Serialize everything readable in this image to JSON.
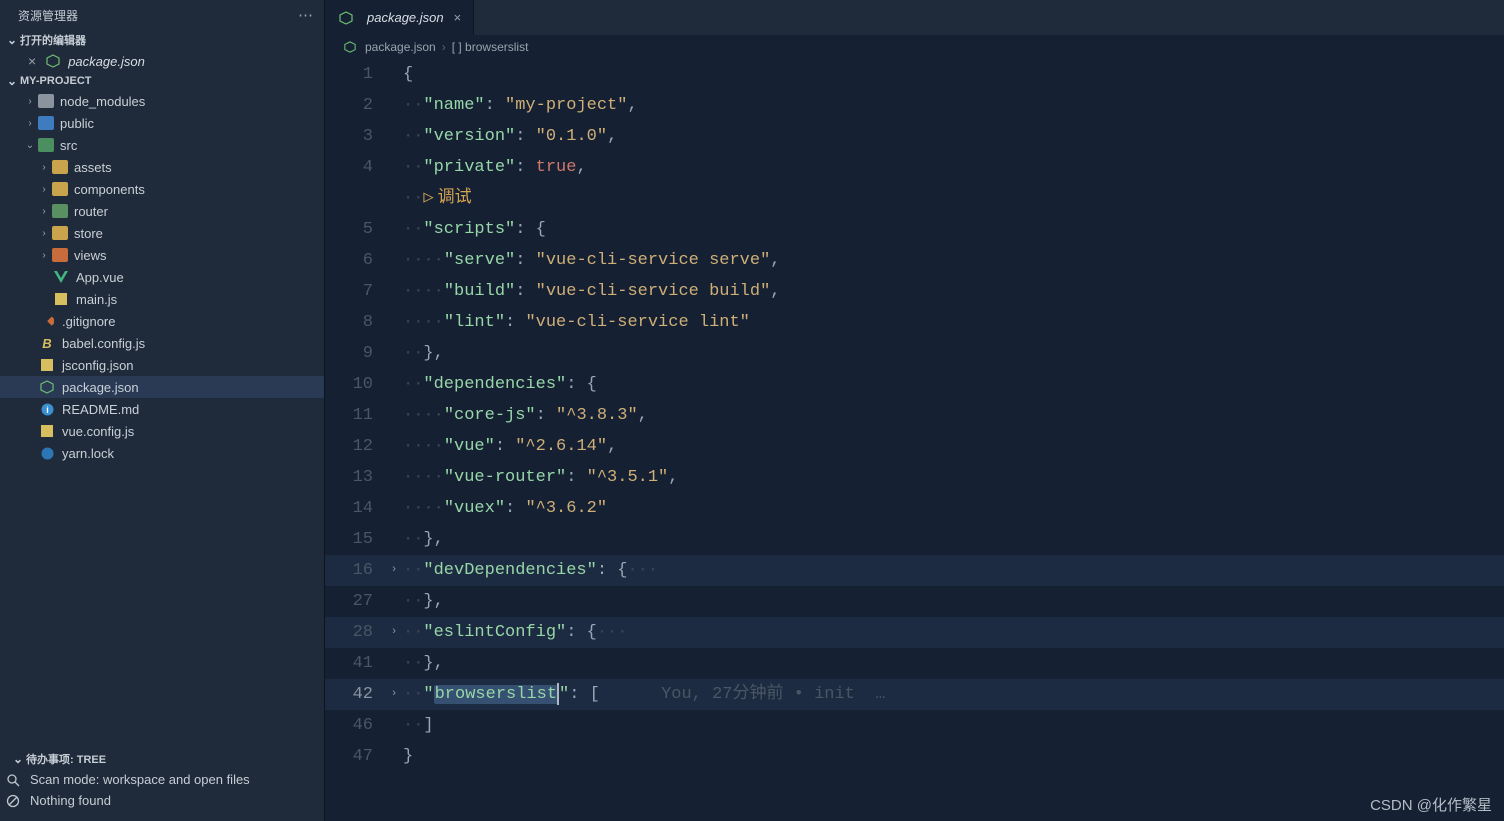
{
  "sidebar": {
    "title": "资源管理器",
    "openEditorsLabel": "打开的编辑器",
    "openItem": "package.json",
    "project": "MY-PROJECT",
    "tree": [
      {
        "d": 1,
        "ar": "›",
        "t": "f",
        "lab": "node_modules",
        "c": "#8b949e"
      },
      {
        "d": 1,
        "ar": "›",
        "t": "f",
        "lab": "public",
        "c": "#3f7bbf"
      },
      {
        "d": 1,
        "ar": "⌄",
        "t": "f",
        "lab": "src",
        "c": "#4b8f61"
      },
      {
        "d": 2,
        "ar": "›",
        "t": "f",
        "lab": "assets",
        "c": "#c9a44c"
      },
      {
        "d": 2,
        "ar": "›",
        "t": "f",
        "lab": "components",
        "c": "#c9a44c"
      },
      {
        "d": 2,
        "ar": "›",
        "t": "f",
        "lab": "router",
        "c": "#5a8f61"
      },
      {
        "d": 2,
        "ar": "›",
        "t": "f",
        "lab": "store",
        "c": "#c9a44c"
      },
      {
        "d": 2,
        "ar": "›",
        "t": "f",
        "lab": "views",
        "c": "#c76c3a"
      },
      {
        "d": 2,
        "ar": "",
        "t": "vue",
        "lab": "App.vue"
      },
      {
        "d": 2,
        "ar": "",
        "t": "js",
        "lab": "main.js"
      },
      {
        "d": 1,
        "ar": "",
        "t": "git",
        "lab": ".gitignore"
      },
      {
        "d": 1,
        "ar": "",
        "t": "babel",
        "lab": "babel.config.js"
      },
      {
        "d": 1,
        "ar": "",
        "t": "jscfg",
        "lab": "jsconfig.json"
      },
      {
        "d": 1,
        "ar": "",
        "t": "npm",
        "lab": "package.json",
        "sel": true
      },
      {
        "d": 1,
        "ar": "",
        "t": "info",
        "lab": "README.md"
      },
      {
        "d": 1,
        "ar": "",
        "t": "js",
        "lab": "vue.config.js"
      },
      {
        "d": 1,
        "ar": "",
        "t": "yarn",
        "lab": "yarn.lock"
      }
    ],
    "todo": {
      "header": "待办事项: TREE",
      "scan": "Scan mode: workspace and open files",
      "nothing": "Nothing found"
    }
  },
  "tab": {
    "label": "package.json"
  },
  "breadcrumb": {
    "file": "package.json",
    "path": "[ ] browserslist"
  },
  "debug": "调试",
  "blame": "You, 27分钟前 • init  …",
  "code": {
    "name_k": "\"name\"",
    "name_v": "\"my-project\"",
    "ver_k": "\"version\"",
    "ver_v": "\"0.1.0\"",
    "priv_k": "\"private\"",
    "priv_v": "true",
    "scripts_k": "\"scripts\"",
    "serve_k": "\"serve\"",
    "serve_v": "\"vue-cli-service serve\"",
    "build_k": "\"build\"",
    "build_v": "\"vue-cli-service build\"",
    "lint_k": "\"lint\"",
    "lint_v": "\"vue-cli-service lint\"",
    "deps_k": "\"dependencies\"",
    "core_k": "\"core-js\"",
    "core_v": "\"^3.8.3\"",
    "vue_k": "\"vue\"",
    "vue_v": "\"^2.6.14\"",
    "vr_k": "\"vue-router\"",
    "vr_v": "\"^3.5.1\"",
    "vx_k": "\"vuex\"",
    "vx_v": "\"^3.6.2\"",
    "dev_k": "\"devDependencies\"",
    "es_k": "\"eslintConfig\"",
    "bl_k": "browserslist"
  },
  "ln": {
    "1": "1",
    "2": "2",
    "3": "3",
    "4": "4",
    "5": "5",
    "6": "6",
    "7": "7",
    "8": "8",
    "9": "9",
    "10": "10",
    "11": "11",
    "12": "12",
    "13": "13",
    "14": "14",
    "15": "15",
    "16": "16",
    "27": "27",
    "28": "28",
    "41": "41",
    "42": "42",
    "46": "46",
    "47": "47"
  },
  "watermark": "CSDN @化作繁星"
}
